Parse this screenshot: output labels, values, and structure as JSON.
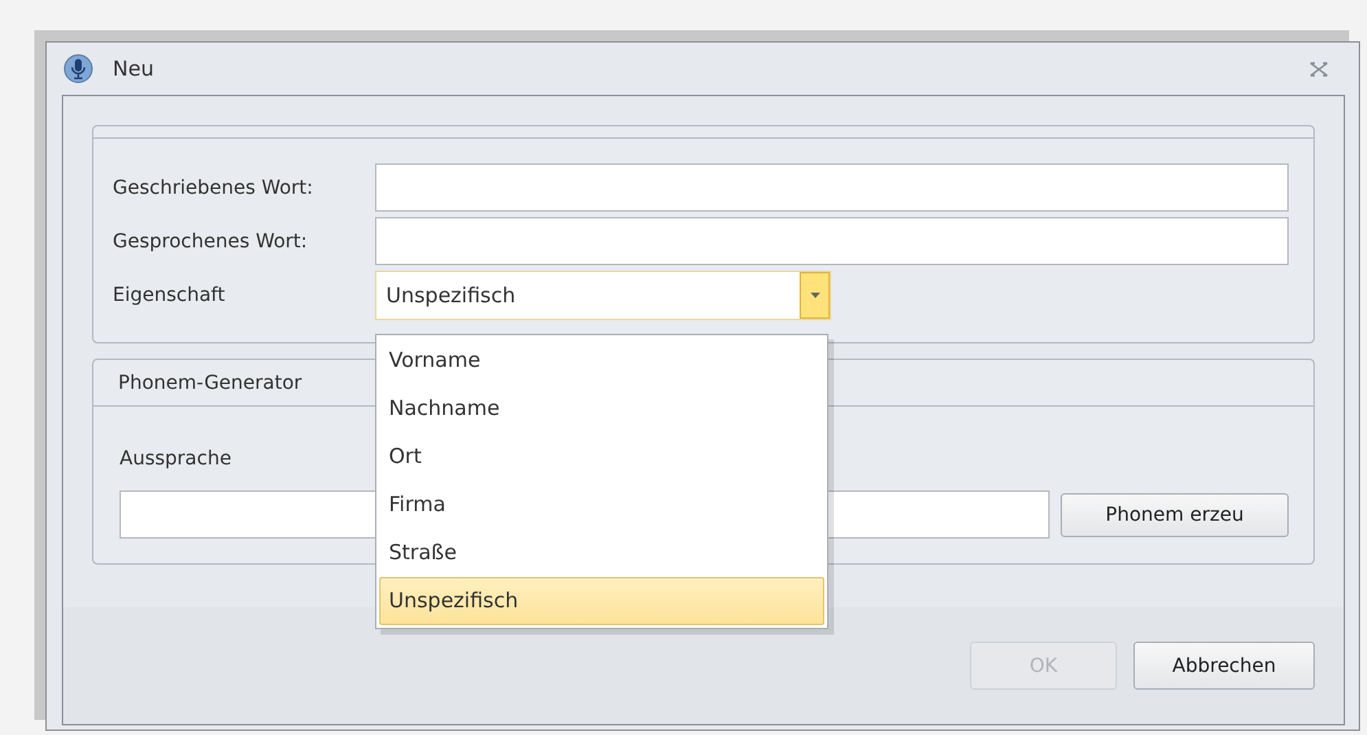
{
  "window": {
    "title": "Neu"
  },
  "fields": [
    {
      "label": "Geschriebenes Wort:"
    },
    {
      "label": "Gesprochenes Wort:"
    }
  ],
  "property": {
    "label": "Eigenschaft",
    "value": "Unspezifisch",
    "expanded": true,
    "options": [
      {
        "label": "Vorname",
        "selected": false
      },
      {
        "label": "Nachname",
        "selected": false
      },
      {
        "label": "Ort",
        "selected": false
      },
      {
        "label": "Firma",
        "selected": false
      },
      {
        "label": "Straße",
        "selected": false
      },
      {
        "label": "Unspezifisch",
        "selected": true
      }
    ]
  },
  "phonem_generator": {
    "title": "Phonem-Generator",
    "label": "Aussprache",
    "button": "Phonem erzeu"
  },
  "buttons": [
    {
      "label": "OK",
      "disabled": true
    },
    {
      "label": "Abbrechen",
      "disabled": false
    }
  ]
}
